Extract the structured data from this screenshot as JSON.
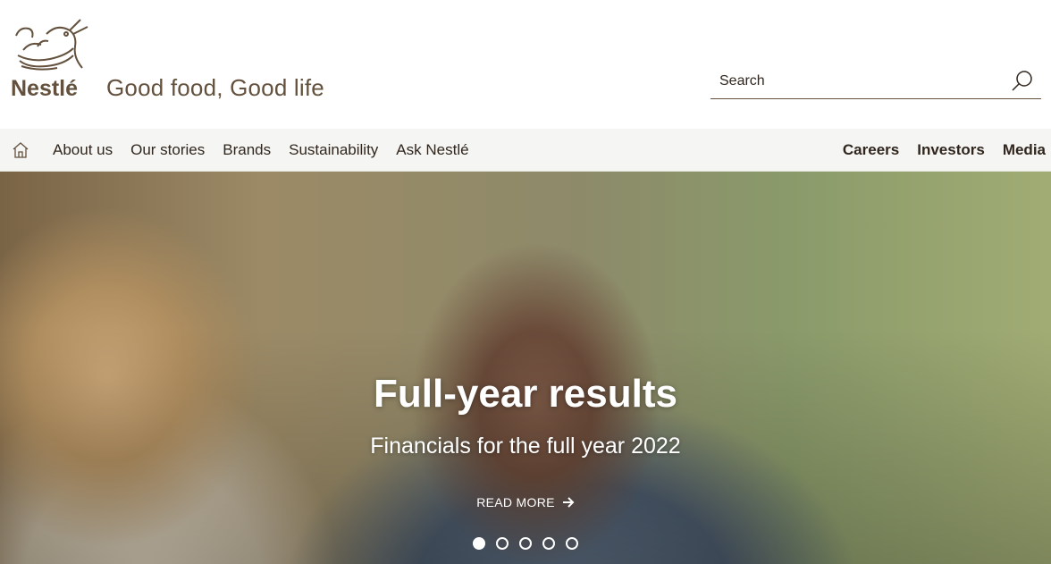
{
  "header": {
    "tagline": "Good food, Good life"
  },
  "brand": {
    "logo_text": "Nestlé",
    "logo_icon": "nest-birds-icon",
    "brand_color": "#63513d"
  },
  "search": {
    "placeholder": "Search",
    "icon": "search-icon"
  },
  "nav": {
    "home_icon": "home-icon",
    "items": [
      {
        "label": "About us"
      },
      {
        "label": "Our stories"
      },
      {
        "label": "Brands"
      },
      {
        "label": "Sustainability"
      },
      {
        "label": "Ask Nestlé"
      }
    ],
    "right_items": [
      {
        "label": "Careers"
      },
      {
        "label": "Investors"
      },
      {
        "label": "Media"
      }
    ]
  },
  "hero": {
    "title": "Full-year results",
    "subtitle": "Financials for the full year 2022",
    "cta": "READ MORE",
    "cta_icon": "arrow-right-icon",
    "slides": 5,
    "active_slide": 1
  }
}
